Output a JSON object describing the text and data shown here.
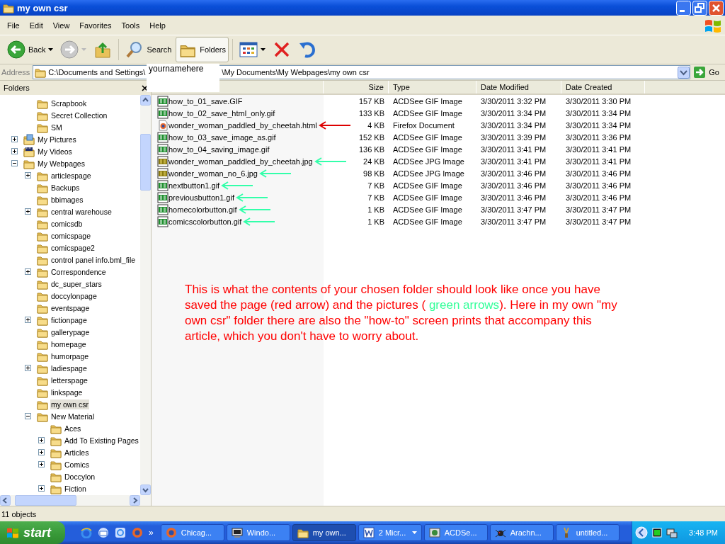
{
  "window": {
    "title": "my own csr"
  },
  "menu": [
    "File",
    "Edit",
    "View",
    "Favorites",
    "Tools",
    "Help"
  ],
  "toolbar": [
    {
      "kind": "back",
      "label": "Back"
    },
    {
      "kind": "forward",
      "disabled": true
    },
    {
      "kind": "up"
    },
    {
      "kind": "search",
      "label": "Search",
      "selected": false
    },
    {
      "kind": "folders",
      "label": "Folders",
      "selected": true
    },
    {
      "kind": "views"
    },
    {
      "kind": "delete"
    },
    {
      "kind": "undo"
    }
  ],
  "address": {
    "label": "Address",
    "value_start": "C:\\Documents and Settings\\",
    "username": "yournamehere",
    "value_end": "\\My Documents\\My Webpages\\my own csr",
    "go": "Go"
  },
  "folders_pane": {
    "title": "Folders",
    "tree": [
      {
        "children": [
          {
            "label": "Scrapbook",
            "kind": "folder",
            "selected": false
          },
          {
            "label": "Secret Collection",
            "kind": "folder",
            "selected": false
          },
          {
            "label": "SM",
            "kind": "folder",
            "selected": false
          }
        ]
      },
      {
        "label": "My Pictures",
        "kind": "pictures",
        "expanded": false,
        "selected": false
      },
      {
        "label": "My Videos",
        "kind": "videos",
        "expanded": false,
        "selected": false
      },
      {
        "label": "My Webpages",
        "kind": "folder",
        "expanded": true,
        "selected": false,
        "children": [
          {
            "label": "articlespage",
            "kind": "folder",
            "expanded": false,
            "selected": false
          },
          {
            "label": "Backups",
            "kind": "folder",
            "selected": false
          },
          {
            "label": "bbimages",
            "kind": "folder",
            "selected": false
          },
          {
            "label": "central warehouse",
            "kind": "folder",
            "expanded": false,
            "selected": false
          },
          {
            "label": "comicsdb",
            "kind": "folder",
            "selected": false
          },
          {
            "label": "comicspage",
            "kind": "folder",
            "selected": false
          },
          {
            "label": "comicspage2",
            "kind": "folder",
            "selected": false
          },
          {
            "label": "control panel info.bml_file",
            "kind": "folder",
            "selected": false
          },
          {
            "label": "Correspondence",
            "kind": "folder",
            "expanded": false,
            "selected": false
          },
          {
            "label": "dc_super_stars",
            "kind": "folder",
            "selected": false
          },
          {
            "label": "doccylonpage",
            "kind": "folder",
            "selected": false
          },
          {
            "label": "eventspage",
            "kind": "folder",
            "selected": false
          },
          {
            "label": "fictionpage",
            "kind": "folder",
            "expanded": false,
            "selected": false
          },
          {
            "label": "gallerypage",
            "kind": "folder",
            "selected": false
          },
          {
            "label": "homepage",
            "kind": "folder",
            "selected": false
          },
          {
            "label": "humorpage",
            "kind": "folder",
            "selected": false
          },
          {
            "label": "ladiespage",
            "kind": "folder",
            "expanded": false,
            "selected": false
          },
          {
            "label": "letterspage",
            "kind": "folder",
            "selected": false
          },
          {
            "label": "linkspage",
            "kind": "folder",
            "selected": false
          },
          {
            "label": "my own csr",
            "kind": "folder",
            "selected": true
          },
          {
            "label": "New Material",
            "kind": "folder",
            "expanded": true,
            "selected": false,
            "children": [
              {
                "label": "Aces",
                "kind": "folder",
                "selected": false
              },
              {
                "label": "Add To Existing Pages",
                "kind": "folder",
                "expanded": false,
                "selected": false
              },
              {
                "label": "Articles",
                "kind": "folder",
                "expanded": false,
                "selected": false
              },
              {
                "label": "Comics",
                "kind": "folder",
                "expanded": false,
                "selected": false
              },
              {
                "label": "Doccylon",
                "kind": "folder",
                "selected": false
              },
              {
                "label": "Fiction",
                "kind": "folder",
                "expanded": false,
                "selected": false
              }
            ]
          }
        ]
      }
    ]
  },
  "file_list": {
    "columns": [
      "Size",
      "Type",
      "Date Modified",
      "Date Created"
    ],
    "rows": [
      {
        "name": "how_to_01_save.GIF",
        "kind": "gif",
        "size": "157 KB",
        "type": "ACDSee GIF Image",
        "modified": "3/30/2011 3:32 PM",
        "created": "3/30/2011 3:30 PM"
      },
      {
        "name": "how_to_02_save_html_only.gif",
        "kind": "gif",
        "size": "133 KB",
        "type": "ACDSee GIF Image",
        "modified": "3/30/2011 3:34 PM",
        "created": "3/30/2011 3:34 PM"
      },
      {
        "name": "wonder_woman_paddled_by_cheetah.html",
        "kind": "firefox",
        "size": "4 KB",
        "type": "Firefox Document",
        "modified": "3/30/2011 3:34 PM",
        "created": "3/30/2011 3:34 PM",
        "color": "#dd0000"
      },
      {
        "name": "how_to_03_save_image_as.gif",
        "kind": "gif",
        "size": "152 KB",
        "type": "ACDSee GIF Image",
        "modified": "3/30/2011 3:39 PM",
        "created": "3/30/2011 3:36 PM"
      },
      {
        "name": "how_to_04_saving_image.gif",
        "kind": "gif",
        "size": "136 KB",
        "type": "ACDSee GIF Image",
        "modified": "3/30/2011 3:41 PM",
        "created": "3/30/2011 3:41 PM"
      },
      {
        "name": "wonder_woman_paddled_by_cheetah.jpg",
        "kind": "jpg",
        "size": "24 KB",
        "type": "ACDSee JPG Image",
        "modified": "3/30/2011 3:41 PM",
        "created": "3/30/2011 3:41 PM",
        "color": "#33ffaa"
      },
      {
        "name": "wonder_woman_no_6.jpg",
        "kind": "jpg",
        "size": "98 KB",
        "type": "ACDSee JPG Image",
        "modified": "3/30/2011 3:46 PM",
        "created": "3/30/2011 3:46 PM",
        "color": "#33ffaa"
      },
      {
        "name": "nextbutton1.gif",
        "kind": "gif",
        "size": "7 KB",
        "type": "ACDSee GIF Image",
        "modified": "3/30/2011 3:46 PM",
        "created": "3/30/2011 3:46 PM",
        "color": "#33ffaa"
      },
      {
        "name": "previousbutton1.gif",
        "kind": "gif",
        "size": "7 KB",
        "type": "ACDSee GIF Image",
        "modified": "3/30/2011 3:46 PM",
        "created": "3/30/2011 3:46 PM",
        "color": "#33ffaa"
      },
      {
        "name": "homecolorbutton.gif",
        "kind": "gif",
        "size": "1 KB",
        "type": "ACDSee GIF Image",
        "modified": "3/30/2011 3:47 PM",
        "created": "3/30/2011 3:47 PM",
        "color": "#33ffaa"
      },
      {
        "name": "comicscolorbutton.gif",
        "kind": "gif",
        "size": "1 KB",
        "type": "ACDSee GIF Image",
        "modified": "3/30/2011 3:47 PM",
        "created": "3/30/2011 3:47 PM",
        "color": "#33ffaa"
      }
    ]
  },
  "annotation": {
    "segments": [
      {
        "text": "This is what the contents of your chosen folder should look like once you have saved the page (red arrow) and the pictures ( ",
        "color": "#ff0000"
      },
      {
        "text": "green arrows",
        "color": "#33ff99"
      },
      {
        "text": ").  Here in my own \"my own csr\" folder there are also the \"how-to\" screen prints that accompany this article, which you don't have to worry about.",
        "color": "#ff0000"
      }
    ]
  },
  "status_bar": {
    "text": "11 objects"
  },
  "taskbar": {
    "start": "start",
    "quick_launch": [
      {
        "kind": "ie"
      },
      {
        "kind": "mail"
      },
      {
        "kind": "ie2"
      },
      {
        "kind": "firefox"
      }
    ],
    "more": "»",
    "tasks": [
      {
        "label": "Chicag...",
        "kind": "firefox",
        "selected": false
      },
      {
        "label": "Windo...",
        "kind": "computer",
        "selected": false
      },
      {
        "label": "my own...",
        "kind": "folder",
        "selected": true
      },
      {
        "label": "2 Micr...",
        "kind": "word",
        "selected": false,
        "group": true
      },
      {
        "label": "ACDSe...",
        "kind": "photo",
        "selected": false
      },
      {
        "label": "Arachn...",
        "kind": "spider",
        "selected": false
      },
      {
        "label": "untitled...",
        "kind": "brush",
        "selected": false
      }
    ],
    "clock": "3:48 PM"
  }
}
